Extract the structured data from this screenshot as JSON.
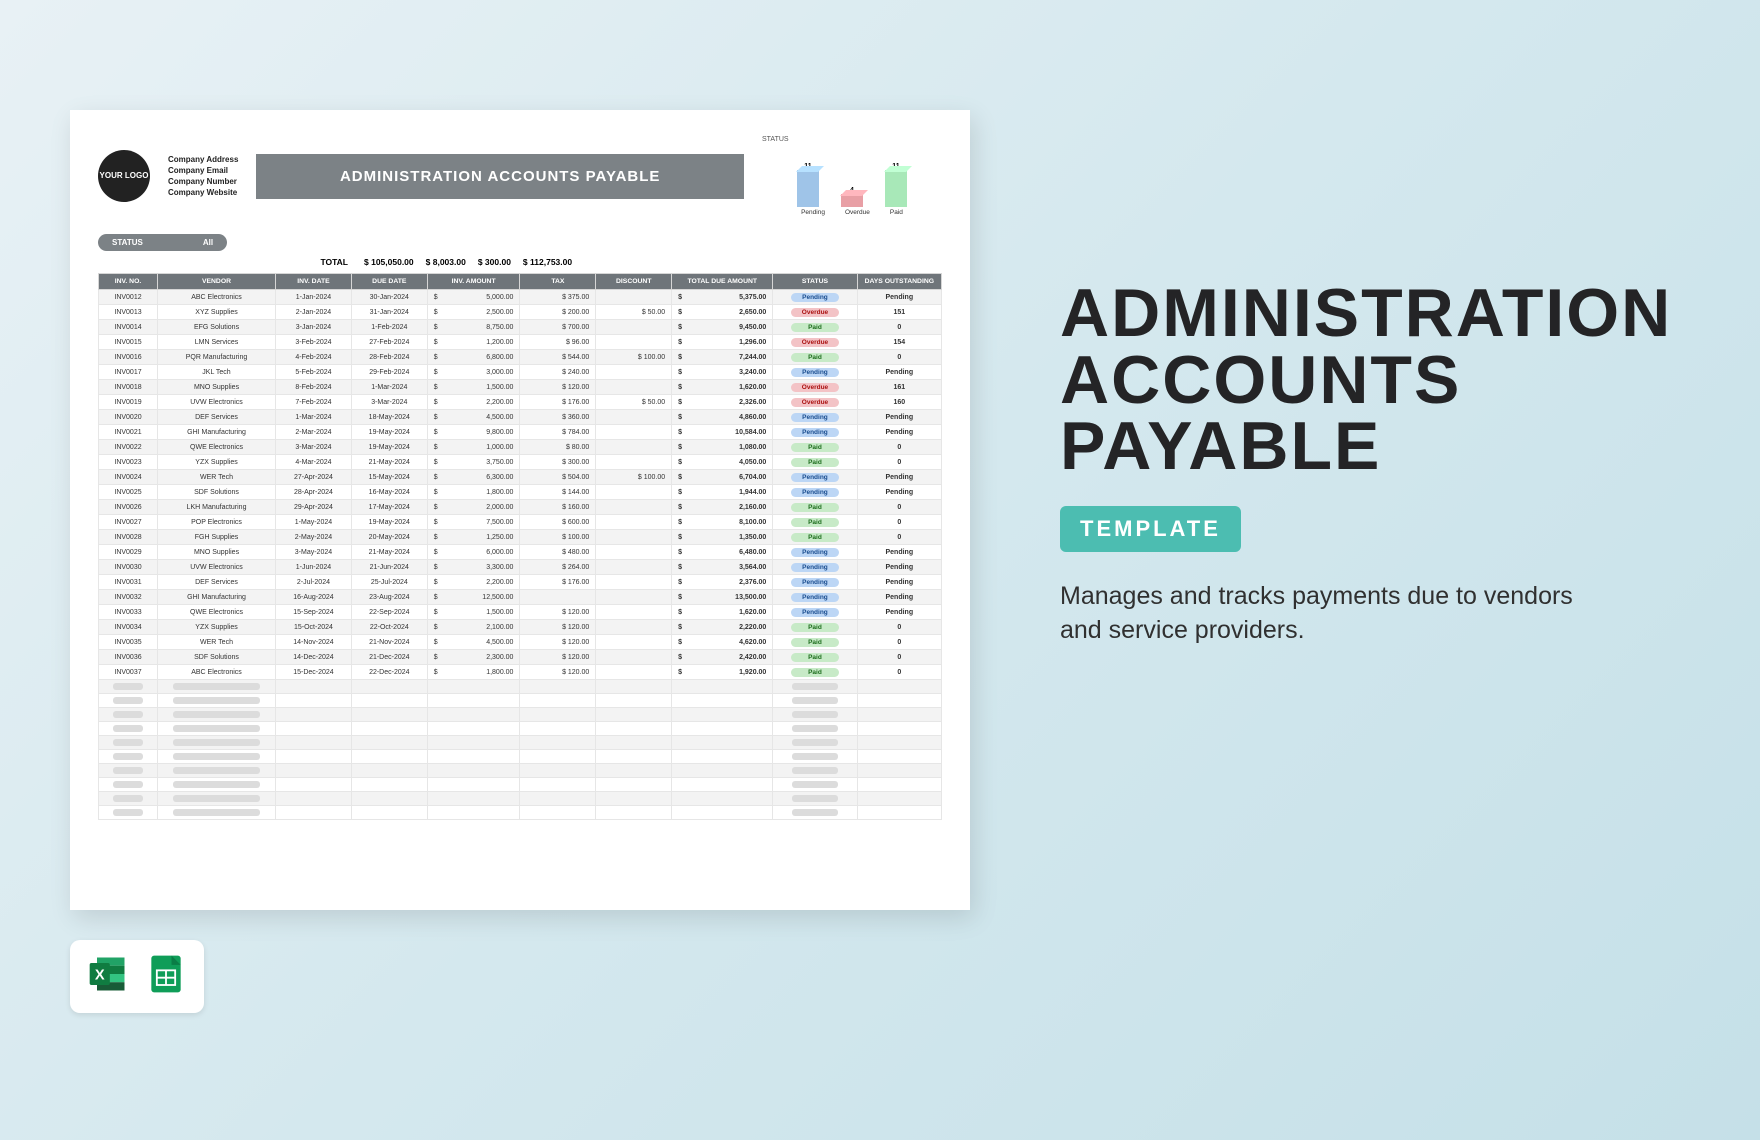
{
  "header": {
    "logo_text": "YOUR LOGO",
    "company_lines": [
      "Company Address",
      "Company Email",
      "Company Number",
      "Company Website"
    ],
    "title": "ADMINISTRATION ACCOUNTS PAYABLE"
  },
  "filter": {
    "label": "STATUS",
    "value": "All"
  },
  "totals": {
    "label": "TOTAL",
    "inv_amount": "105,050.00",
    "tax": "8,003.00",
    "discount": "300.00",
    "total_due": "112,753.00"
  },
  "columns": [
    "INV. NO.",
    "VENDOR",
    "INV. DATE",
    "DUE DATE",
    "INV. AMOUNT",
    "TAX",
    "DISCOUNT",
    "TOTAL DUE AMOUNT",
    "STATUS",
    "DAYS OUTSTANDING"
  ],
  "rows": [
    {
      "no": "INV0012",
      "vendor": "ABC Electronics",
      "inv": "1-Jan-2024",
      "due": "30-Jan-2024",
      "amt": "5,000.00",
      "tax": "375.00",
      "disc": "",
      "tot": "5,375.00",
      "status": "Pending",
      "days": "Pending"
    },
    {
      "no": "INV0013",
      "vendor": "XYZ Supplies",
      "inv": "2-Jan-2024",
      "due": "31-Jan-2024",
      "amt": "2,500.00",
      "tax": "200.00",
      "disc": "50.00",
      "tot": "2,650.00",
      "status": "Overdue",
      "days": "151"
    },
    {
      "no": "INV0014",
      "vendor": "EFG Solutions",
      "inv": "3-Jan-2024",
      "due": "1-Feb-2024",
      "amt": "8,750.00",
      "tax": "700.00",
      "disc": "",
      "tot": "9,450.00",
      "status": "Paid",
      "days": "0"
    },
    {
      "no": "INV0015",
      "vendor": "LMN Services",
      "inv": "3-Feb-2024",
      "due": "27-Feb-2024",
      "amt": "1,200.00",
      "tax": "96.00",
      "disc": "",
      "tot": "1,296.00",
      "status": "Overdue",
      "days": "154"
    },
    {
      "no": "INV0016",
      "vendor": "PQR Manufacturing",
      "inv": "4-Feb-2024",
      "due": "28-Feb-2024",
      "amt": "6,800.00",
      "tax": "544.00",
      "disc": "100.00",
      "tot": "7,244.00",
      "status": "Paid",
      "days": "0"
    },
    {
      "no": "INV0017",
      "vendor": "JKL Tech",
      "inv": "5-Feb-2024",
      "due": "29-Feb-2024",
      "amt": "3,000.00",
      "tax": "240.00",
      "disc": "",
      "tot": "3,240.00",
      "status": "Pending",
      "days": "Pending"
    },
    {
      "no": "INV0018",
      "vendor": "MNO Supplies",
      "inv": "8-Feb-2024",
      "due": "1-Mar-2024",
      "amt": "1,500.00",
      "tax": "120.00",
      "disc": "",
      "tot": "1,620.00",
      "status": "Overdue",
      "days": "161"
    },
    {
      "no": "INV0019",
      "vendor": "UVW Electronics",
      "inv": "7-Feb-2024",
      "due": "3-Mar-2024",
      "amt": "2,200.00",
      "tax": "176.00",
      "disc": "50.00",
      "tot": "2,326.00",
      "status": "Overdue",
      "days": "160"
    },
    {
      "no": "INV0020",
      "vendor": "DEF Services",
      "inv": "1-Mar-2024",
      "due": "18-May-2024",
      "amt": "4,500.00",
      "tax": "360.00",
      "disc": "",
      "tot": "4,860.00",
      "status": "Pending",
      "days": "Pending"
    },
    {
      "no": "INV0021",
      "vendor": "GHI Manufacturing",
      "inv": "2-Mar-2024",
      "due": "19-May-2024",
      "amt": "9,800.00",
      "tax": "784.00",
      "disc": "",
      "tot": "10,584.00",
      "status": "Pending",
      "days": "Pending"
    },
    {
      "no": "INV0022",
      "vendor": "QWE Electronics",
      "inv": "3-Mar-2024",
      "due": "19-May-2024",
      "amt": "1,000.00",
      "tax": "80.00",
      "disc": "",
      "tot": "1,080.00",
      "status": "Paid",
      "days": "0"
    },
    {
      "no": "INV0023",
      "vendor": "YZX Supplies",
      "inv": "4-Mar-2024",
      "due": "21-May-2024",
      "amt": "3,750.00",
      "tax": "300.00",
      "disc": "",
      "tot": "4,050.00",
      "status": "Paid",
      "days": "0"
    },
    {
      "no": "INV0024",
      "vendor": "WER Tech",
      "inv": "27-Apr-2024",
      "due": "15-May-2024",
      "amt": "6,300.00",
      "tax": "504.00",
      "disc": "100.00",
      "tot": "6,704.00",
      "status": "Pending",
      "days": "Pending"
    },
    {
      "no": "INV0025",
      "vendor": "SDF Solutions",
      "inv": "28-Apr-2024",
      "due": "16-May-2024",
      "amt": "1,800.00",
      "tax": "144.00",
      "disc": "",
      "tot": "1,944.00",
      "status": "Pending",
      "days": "Pending"
    },
    {
      "no": "INV0026",
      "vendor": "LKH Manufacturing",
      "inv": "29-Apr-2024",
      "due": "17-May-2024",
      "amt": "2,000.00",
      "tax": "160.00",
      "disc": "",
      "tot": "2,160.00",
      "status": "Paid",
      "days": "0"
    },
    {
      "no": "INV0027",
      "vendor": "POP Electronics",
      "inv": "1-May-2024",
      "due": "19-May-2024",
      "amt": "7,500.00",
      "tax": "600.00",
      "disc": "",
      "tot": "8,100.00",
      "status": "Paid",
      "days": "0"
    },
    {
      "no": "INV0028",
      "vendor": "FGH Supplies",
      "inv": "2-May-2024",
      "due": "20-May-2024",
      "amt": "1,250.00",
      "tax": "100.00",
      "disc": "",
      "tot": "1,350.00",
      "status": "Paid",
      "days": "0"
    },
    {
      "no": "INV0029",
      "vendor": "MNO Supplies",
      "inv": "3-May-2024",
      "due": "21-May-2024",
      "amt": "6,000.00",
      "tax": "480.00",
      "disc": "",
      "tot": "6,480.00",
      "status": "Pending",
      "days": "Pending"
    },
    {
      "no": "INV0030",
      "vendor": "UVW Electronics",
      "inv": "1-Jun-2024",
      "due": "21-Jun-2024",
      "amt": "3,300.00",
      "tax": "264.00",
      "disc": "",
      "tot": "3,564.00",
      "status": "Pending",
      "days": "Pending"
    },
    {
      "no": "INV0031",
      "vendor": "DEF Services",
      "inv": "2-Jul-2024",
      "due": "25-Jul-2024",
      "amt": "2,200.00",
      "tax": "176.00",
      "disc": "",
      "tot": "2,376.00",
      "status": "Pending",
      "days": "Pending"
    },
    {
      "no": "INV0032",
      "vendor": "GHI Manufacturing",
      "inv": "16-Aug-2024",
      "due": "23-Aug-2024",
      "amt": "12,500.00",
      "tax": "",
      "disc": "",
      "tot": "13,500.00",
      "status": "Pending",
      "days": "Pending"
    },
    {
      "no": "INV0033",
      "vendor": "QWE Electronics",
      "inv": "15-Sep-2024",
      "due": "22-Sep-2024",
      "amt": "1,500.00",
      "tax": "120.00",
      "disc": "",
      "tot": "1,620.00",
      "status": "Pending",
      "days": "Pending"
    },
    {
      "no": "INV0034",
      "vendor": "YZX Supplies",
      "inv": "15-Oct-2024",
      "due": "22-Oct-2024",
      "amt": "2,100.00",
      "tax": "120.00",
      "disc": "",
      "tot": "2,220.00",
      "status": "Paid",
      "days": "0"
    },
    {
      "no": "INV0035",
      "vendor": "WER Tech",
      "inv": "14-Nov-2024",
      "due": "21-Nov-2024",
      "amt": "4,500.00",
      "tax": "120.00",
      "disc": "",
      "tot": "4,620.00",
      "status": "Paid",
      "days": "0"
    },
    {
      "no": "INV0036",
      "vendor": "SDF Solutions",
      "inv": "14-Dec-2024",
      "due": "21-Dec-2024",
      "amt": "2,300.00",
      "tax": "120.00",
      "disc": "",
      "tot": "2,420.00",
      "status": "Paid",
      "days": "0"
    },
    {
      "no": "INV0037",
      "vendor": "ABC Electronics",
      "inv": "15-Dec-2024",
      "due": "22-Dec-2024",
      "amt": "1,800.00",
      "tax": "120.00",
      "disc": "",
      "tot": "1,920.00",
      "status": "Paid",
      "days": "0"
    }
  ],
  "empty_rows": 10,
  "chart_data": {
    "type": "bar",
    "title": "STATUS",
    "categories": [
      "Pending",
      "Overdue",
      "Paid"
    ],
    "values": [
      11,
      4,
      11
    ],
    "ylim": [
      0,
      15
    ],
    "colors": [
      "#9fc4e8",
      "#e89fa5",
      "#a8e8b8"
    ]
  },
  "promo": {
    "title_lines": [
      "ADMINISTRATION",
      "ACCOUNTS",
      "PAYABLE"
    ],
    "badge": "TEMPLATE",
    "description": "Manages and tracks payments due to vendors and service providers."
  },
  "apps": {
    "excel": "Microsoft Excel",
    "sheets": "Google Sheets"
  }
}
